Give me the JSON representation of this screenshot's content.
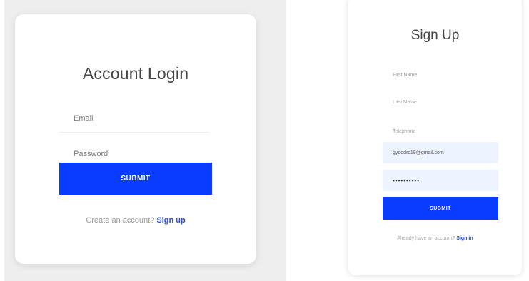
{
  "login": {
    "title": "Account Login",
    "email_placeholder": "Email",
    "password_placeholder": "Password",
    "submit_label": "SUBMIT",
    "footer_text": "Create an account?",
    "footer_link": "Sign up"
  },
  "signup": {
    "title": "Sign Up",
    "first_name_placeholder": "First Name",
    "last_name_placeholder": "Last Name",
    "telephone_placeholder": "Telephone",
    "email_value": "gyoodrc19@gmail.com",
    "password_value": "••••••••••",
    "submit_label": "SUBMIT",
    "footer_text": "Already have an account?",
    "footer_link": "Sign in"
  }
}
